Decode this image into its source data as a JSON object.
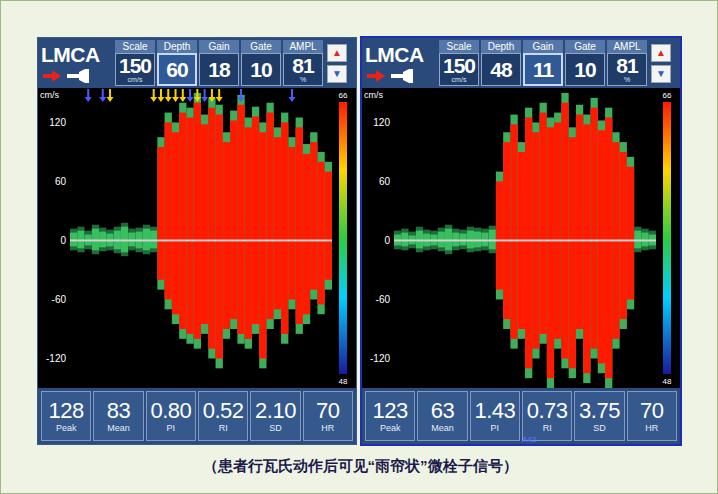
{
  "caption": "（患者行瓦氏动作后可见“雨帘状”微栓子信号）",
  "panels": [
    {
      "selected": false,
      "vessel": "LMCA",
      "up": "▲",
      "down": "▼",
      "params": [
        {
          "label": "Scale",
          "value": "150",
          "unit": "cm/s",
          "selected": false
        },
        {
          "label": "Depth",
          "value": "60",
          "selected": true
        },
        {
          "label": "Gain",
          "value": "18",
          "selected": false
        },
        {
          "label": "Gate",
          "value": "10",
          "selected": false
        },
        {
          "label": "AMPL",
          "value": "81",
          "unit": "%",
          "selected": false
        }
      ],
      "chart": {
        "unit": "cm/s",
        "ticks": [
          "120",
          "60",
          "0",
          "-60",
          "-120"
        ],
        "colorbar": {
          "top": "66",
          "bottom": "48"
        },
        "positive": [
          8,
          10,
          6,
          12,
          9,
          7,
          10,
          14,
          8,
          9,
          12,
          10,
          95,
          120,
          110,
          130,
          125,
          140,
          118,
          135,
          128,
          100,
          122,
          138,
          115,
          126,
          110,
          130,
          105,
          120,
          95,
          115,
          88,
          100,
          80,
          70
        ],
        "negative": [
          -6,
          -8,
          -5,
          -10,
          -7,
          -6,
          -9,
          -12,
          -6,
          -8,
          -10,
          -8,
          -40,
          -60,
          -75,
          -90,
          -95,
          -100,
          -85,
          -110,
          -120,
          -90,
          -80,
          -95,
          -100,
          -85,
          -120,
          -80,
          -70,
          -95,
          -60,
          -85,
          -75,
          -50,
          -65,
          -40
        ],
        "markers": [
          {
            "color": "#4a5cff",
            "t": 2
          },
          {
            "color": "#4a5cff",
            "t": 4
          },
          {
            "color": "#f5d300",
            "t": 5
          },
          {
            "color": "#f5d300",
            "t": 11
          },
          {
            "color": "#f5d300",
            "t": 12
          },
          {
            "color": "#f5d300",
            "t": 13
          },
          {
            "color": "#f5d300",
            "t": 14
          },
          {
            "color": "#f5d300",
            "t": 15
          },
          {
            "color": "#4a5cff",
            "t": 16
          },
          {
            "color": "#f5d300",
            "t": 17
          },
          {
            "color": "#4a5cff",
            "t": 18
          },
          {
            "color": "#f5d300",
            "t": 19
          },
          {
            "color": "#f5d300",
            "t": 20
          },
          {
            "color": "#4a5cff",
            "t": 23
          },
          {
            "color": "#4a5cff",
            "t": 30
          }
        ]
      },
      "readouts": [
        {
          "label": "Peak",
          "value": "128"
        },
        {
          "label": "Mean",
          "value": "83"
        },
        {
          "label": "PI",
          "value": "0.80"
        },
        {
          "label": "RI",
          "value": "0.52"
        },
        {
          "label": "SD",
          "value": "2.10"
        },
        {
          "label": "HR",
          "value": "70"
        }
      ]
    },
    {
      "selected": true,
      "vessel": "LMCA",
      "up": "▲",
      "down": "▼",
      "params": [
        {
          "label": "Scale",
          "value": "150",
          "unit": "cm/s",
          "selected": false
        },
        {
          "label": "Depth",
          "value": "48",
          "selected": false
        },
        {
          "label": "Gain",
          "value": "11",
          "selected": true
        },
        {
          "label": "Gate",
          "value": "10",
          "selected": false
        },
        {
          "label": "AMPL",
          "value": "81",
          "unit": "%",
          "selected": false
        }
      ],
      "chart": {
        "unit": "cm/s",
        "ticks": [
          "120",
          "60",
          "0",
          "-60",
          "-120"
        ],
        "colorbar": {
          "top": "66",
          "bottom": "48"
        },
        "positive": [
          6,
          8,
          5,
          10,
          7,
          6,
          9,
          12,
          8,
          7,
          10,
          9,
          8,
          11,
          60,
          100,
          118,
          90,
          125,
          110,
          130,
          115,
          120,
          140,
          105,
          128,
          118,
          135,
          112,
          125,
          100,
          90,
          75,
          10,
          8,
          6
        ],
        "negative": [
          -5,
          -6,
          -4,
          -8,
          -6,
          -5,
          -7,
          -10,
          -6,
          -5,
          -8,
          -7,
          -6,
          -9,
          -50,
          -80,
          -100,
          -90,
          -130,
          -110,
          -95,
          -140,
          -100,
          -120,
          -130,
          -90,
          -135,
          -110,
          -125,
          -140,
          -100,
          -80,
          -60,
          -8,
          -6,
          -5
        ],
        "markers": []
      },
      "readouts": [
        {
          "label": "Peak",
          "value": "123"
        },
        {
          "label": "Mean",
          "value": "63"
        },
        {
          "label": "PI",
          "value": "1.43"
        },
        {
          "label": "RI",
          "value": "0.73"
        },
        {
          "label": "SD",
          "value": "3.75"
        },
        {
          "label": "HR",
          "value": "70"
        }
      ],
      "overlay": "A42"
    }
  ]
}
